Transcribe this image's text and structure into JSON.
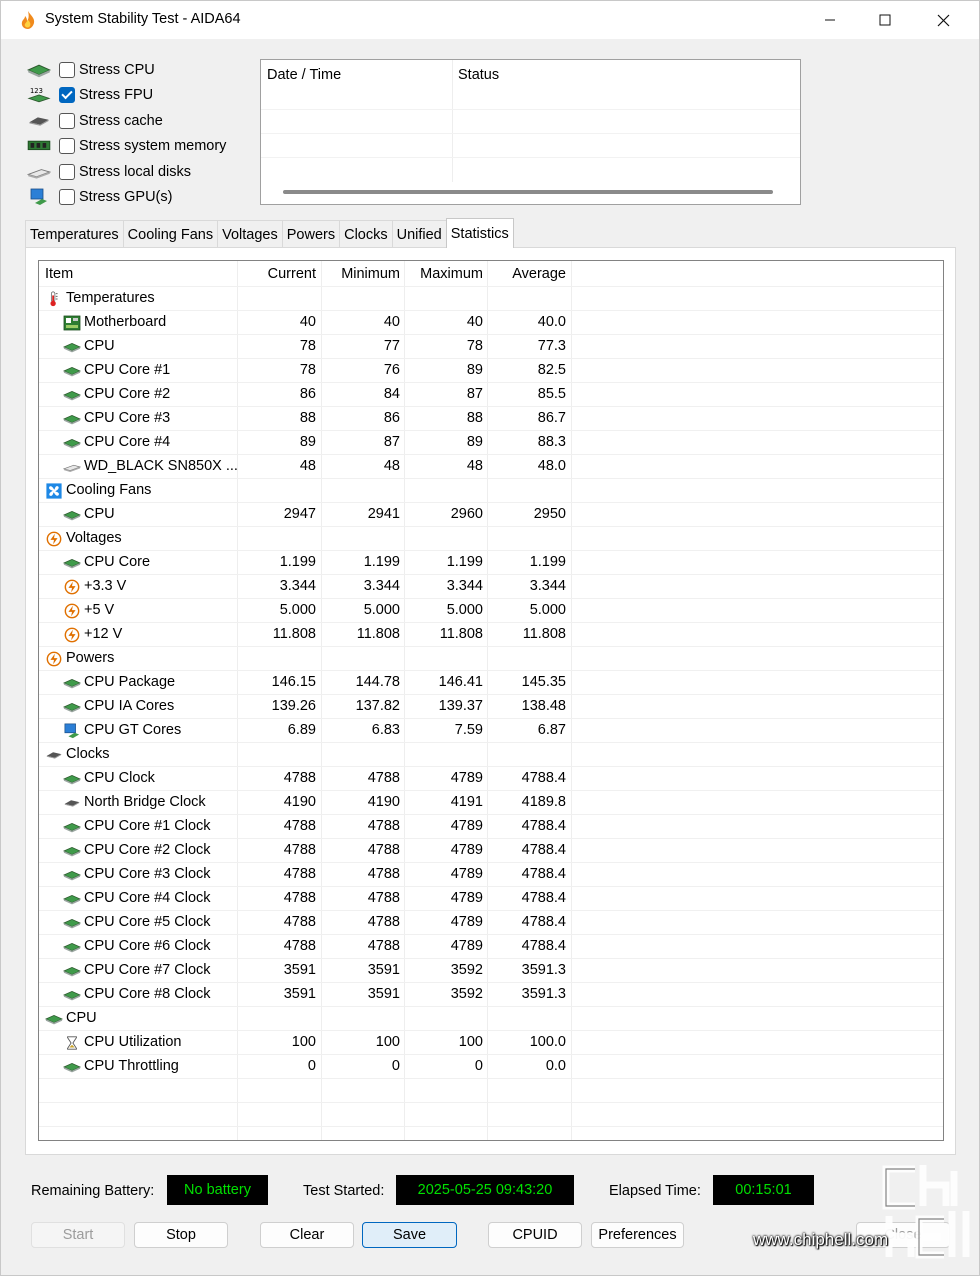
{
  "window": {
    "title": "System Stability Test - AIDA64"
  },
  "stress_options": [
    {
      "label": "Stress CPU",
      "checked": false,
      "icon": "cpu-chip-icon"
    },
    {
      "label": "Stress FPU",
      "checked": true,
      "icon": "fpu-icon"
    },
    {
      "label": "Stress cache",
      "checked": false,
      "icon": "cache-chip-icon"
    },
    {
      "label": "Stress system memory",
      "checked": false,
      "icon": "memory-module-icon"
    },
    {
      "label": "Stress local disks",
      "checked": false,
      "icon": "disk-drive-icon"
    },
    {
      "label": "Stress GPU(s)",
      "checked": false,
      "icon": "gpu-monitor-icon"
    }
  ],
  "log": {
    "col_datetime": "Date / Time",
    "col_status": "Status"
  },
  "tabs": [
    {
      "label": "Temperatures",
      "active": false
    },
    {
      "label": "Cooling Fans",
      "active": false
    },
    {
      "label": "Voltages",
      "active": false
    },
    {
      "label": "Powers",
      "active": false
    },
    {
      "label": "Clocks",
      "active": false
    },
    {
      "label": "Unified",
      "active": false
    },
    {
      "label": "Statistics",
      "active": true
    }
  ],
  "stats": {
    "headers": {
      "item": "Item",
      "current": "Current",
      "minimum": "Minimum",
      "maximum": "Maximum",
      "average": "Average"
    },
    "rows": [
      {
        "level": 0,
        "icon": "thermometer-icon",
        "label": "Temperatures",
        "cur": "",
        "min": "",
        "max": "",
        "avg": ""
      },
      {
        "level": 1,
        "icon": "motherboard-icon",
        "label": "Motherboard",
        "cur": "40",
        "min": "40",
        "max": "40",
        "avg": "40.0"
      },
      {
        "level": 1,
        "icon": "cpu-chip-icon",
        "label": "CPU",
        "cur": "78",
        "min": "77",
        "max": "78",
        "avg": "77.3"
      },
      {
        "level": 1,
        "icon": "cpu-chip-icon",
        "label": "CPU Core #1",
        "cur": "78",
        "min": "76",
        "max": "89",
        "avg": "82.5"
      },
      {
        "level": 1,
        "icon": "cpu-chip-icon",
        "label": "CPU Core #2",
        "cur": "86",
        "min": "84",
        "max": "87",
        "avg": "85.5"
      },
      {
        "level": 1,
        "icon": "cpu-chip-icon",
        "label": "CPU Core #3",
        "cur": "88",
        "min": "86",
        "max": "88",
        "avg": "86.7"
      },
      {
        "level": 1,
        "icon": "cpu-chip-icon",
        "label": "CPU Core #4",
        "cur": "89",
        "min": "87",
        "max": "89",
        "avg": "88.3"
      },
      {
        "level": 1,
        "icon": "disk-drive-icon",
        "label": "WD_BLACK SN850X ...",
        "cur": "48",
        "min": "48",
        "max": "48",
        "avg": "48.0"
      },
      {
        "level": 0,
        "icon": "fan-icon",
        "label": "Cooling Fans",
        "cur": "",
        "min": "",
        "max": "",
        "avg": ""
      },
      {
        "level": 1,
        "icon": "cpu-chip-icon",
        "label": "CPU",
        "cur": "2947",
        "min": "2941",
        "max": "2960",
        "avg": "2950"
      },
      {
        "level": 0,
        "icon": "voltage-icon",
        "label": "Voltages",
        "cur": "",
        "min": "",
        "max": "",
        "avg": ""
      },
      {
        "level": 1,
        "icon": "cpu-chip-icon",
        "label": "CPU Core",
        "cur": "1.199",
        "min": "1.199",
        "max": "1.199",
        "avg": "1.199"
      },
      {
        "level": 1,
        "icon": "voltage-icon",
        "label": "+3.3 V",
        "cur": "3.344",
        "min": "3.344",
        "max": "3.344",
        "avg": "3.344"
      },
      {
        "level": 1,
        "icon": "voltage-icon",
        "label": "+5 V",
        "cur": "5.000",
        "min": "5.000",
        "max": "5.000",
        "avg": "5.000"
      },
      {
        "level": 1,
        "icon": "voltage-icon",
        "label": "+12 V",
        "cur": "11.808",
        "min": "11.808",
        "max": "11.808",
        "avg": "11.808"
      },
      {
        "level": 0,
        "icon": "voltage-icon",
        "label": "Powers",
        "cur": "",
        "min": "",
        "max": "",
        "avg": ""
      },
      {
        "level": 1,
        "icon": "cpu-chip-icon",
        "label": "CPU Package",
        "cur": "146.15",
        "min": "144.78",
        "max": "146.41",
        "avg": "145.35"
      },
      {
        "level": 1,
        "icon": "cpu-chip-icon",
        "label": "CPU IA Cores",
        "cur": "139.26",
        "min": "137.82",
        "max": "139.37",
        "avg": "138.48"
      },
      {
        "level": 1,
        "icon": "gpu-monitor-icon",
        "label": "CPU GT Cores",
        "cur": "6.89",
        "min": "6.83",
        "max": "7.59",
        "avg": "6.87"
      },
      {
        "level": 0,
        "icon": "cache-chip-icon",
        "label": "Clocks",
        "cur": "",
        "min": "",
        "max": "",
        "avg": ""
      },
      {
        "level": 1,
        "icon": "cpu-chip-icon",
        "label": "CPU Clock",
        "cur": "4788",
        "min": "4788",
        "max": "4789",
        "avg": "4788.4"
      },
      {
        "level": 1,
        "icon": "cache-chip-icon",
        "label": "North Bridge Clock",
        "cur": "4190",
        "min": "4190",
        "max": "4191",
        "avg": "4189.8"
      },
      {
        "level": 1,
        "icon": "cpu-chip-icon",
        "label": "CPU Core #1 Clock",
        "cur": "4788",
        "min": "4788",
        "max": "4789",
        "avg": "4788.4"
      },
      {
        "level": 1,
        "icon": "cpu-chip-icon",
        "label": "CPU Core #2 Clock",
        "cur": "4788",
        "min": "4788",
        "max": "4789",
        "avg": "4788.4"
      },
      {
        "level": 1,
        "icon": "cpu-chip-icon",
        "label": "CPU Core #3 Clock",
        "cur": "4788",
        "min": "4788",
        "max": "4789",
        "avg": "4788.4"
      },
      {
        "level": 1,
        "icon": "cpu-chip-icon",
        "label": "CPU Core #4 Clock",
        "cur": "4788",
        "min": "4788",
        "max": "4789",
        "avg": "4788.4"
      },
      {
        "level": 1,
        "icon": "cpu-chip-icon",
        "label": "CPU Core #5 Clock",
        "cur": "4788",
        "min": "4788",
        "max": "4789",
        "avg": "4788.4"
      },
      {
        "level": 1,
        "icon": "cpu-chip-icon",
        "label": "CPU Core #6 Clock",
        "cur": "4788",
        "min": "4788",
        "max": "4789",
        "avg": "4788.4"
      },
      {
        "level": 1,
        "icon": "cpu-chip-icon",
        "label": "CPU Core #7 Clock",
        "cur": "3591",
        "min": "3591",
        "max": "3592",
        "avg": "3591.3"
      },
      {
        "level": 1,
        "icon": "cpu-chip-icon",
        "label": "CPU Core #8 Clock",
        "cur": "3591",
        "min": "3591",
        "max": "3592",
        "avg": "3591.3"
      },
      {
        "level": 0,
        "icon": "cpu-chip-icon",
        "label": "CPU",
        "cur": "",
        "min": "",
        "max": "",
        "avg": ""
      },
      {
        "level": 1,
        "icon": "hourglass-icon",
        "label": "CPU Utilization",
        "cur": "100",
        "min": "100",
        "max": "100",
        "avg": "100.0"
      },
      {
        "level": 1,
        "icon": "cpu-chip-icon",
        "label": "CPU Throttling",
        "cur": "0",
        "min": "0",
        "max": "0",
        "avg": "0.0"
      }
    ]
  },
  "status": {
    "battery_label": "Remaining Battery:",
    "battery_value": "No battery",
    "started_label": "Test Started:",
    "started_value": "2025-05-25 09:43:20",
    "elapsed_label": "Elapsed Time:",
    "elapsed_value": "00:15:01"
  },
  "buttons": {
    "start": "Start",
    "stop": "Stop",
    "clear": "Clear",
    "save": "Save",
    "cpuid": "CPUID",
    "preferences": "Preferences",
    "close": "Close"
  },
  "watermark": {
    "url": "www.chiphell.com"
  },
  "colors": {
    "accent": "#0067c0",
    "led_green": "#00e000",
    "led_bg": "#000000"
  }
}
